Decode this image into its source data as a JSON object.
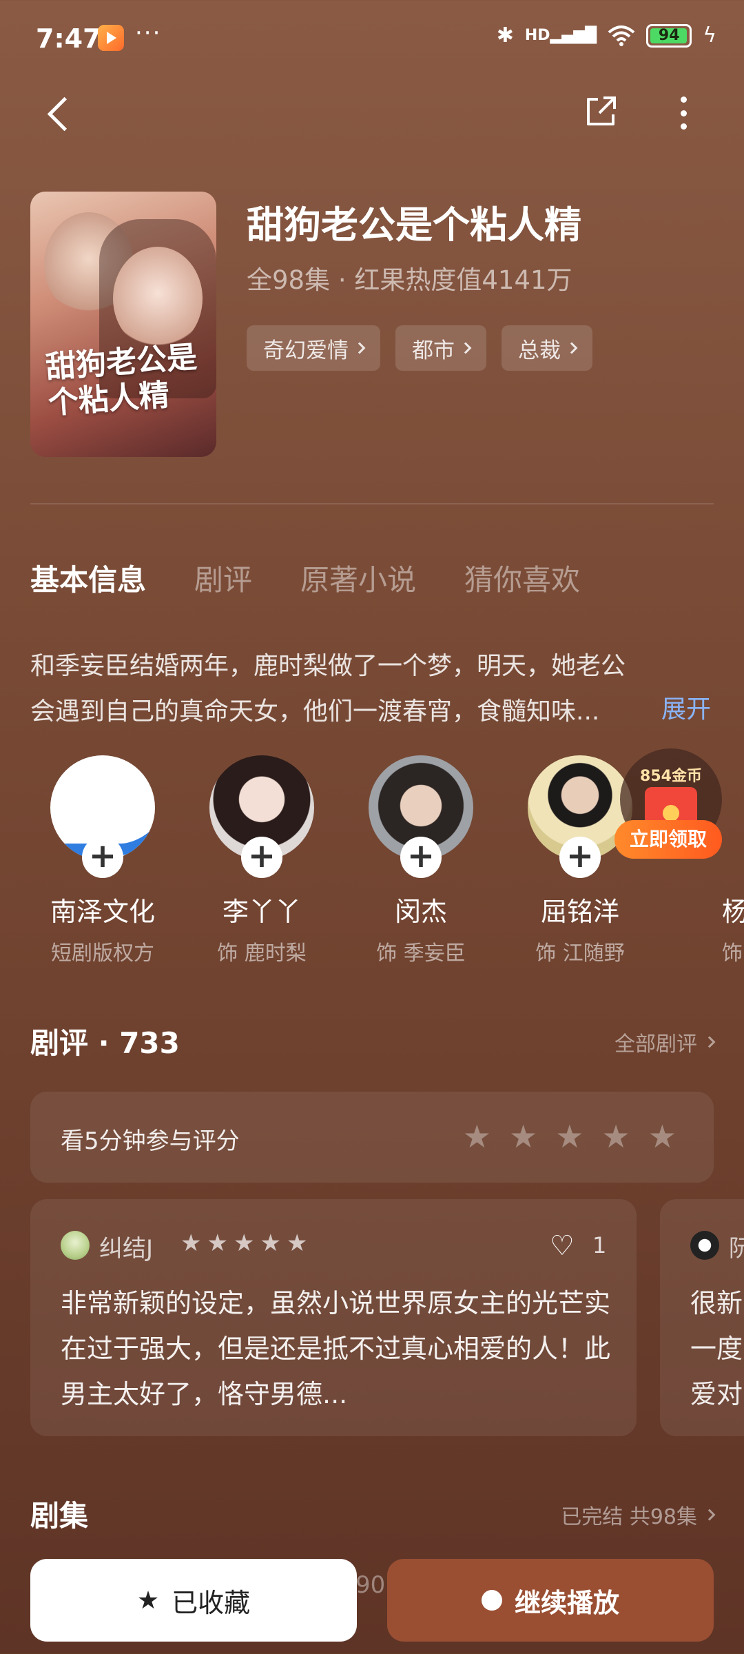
{
  "status_bar": {
    "time": "7:47",
    "dots": "···",
    "network": "HD",
    "battery": "94"
  },
  "show": {
    "poster_title": "甜狗老公是个粘人精",
    "title": "甜狗老公是个粘人精",
    "meta": "全98集 · 红果热度值4141万",
    "tags": [
      "奇幻爱情",
      "都市",
      "总裁"
    ]
  },
  "tabs": [
    "基本信息",
    "剧评",
    "原著小说",
    "猜你喜欢"
  ],
  "synopsis": {
    "text": "和季妄臣结婚两年，鹿时梨做了一个梦，明天，她老公会遇到自己的真命天女，他们一渡春宵，食髓知味...",
    "expand": "展开"
  },
  "cast": [
    {
      "name": "南泽文化",
      "role": "短剧版权方"
    },
    {
      "name": "李丫丫",
      "role": "饰 鹿时梨"
    },
    {
      "name": "闵杰",
      "role": "饰 季妄臣"
    },
    {
      "name": "屈铭洋",
      "role": "饰 江随野"
    },
    {
      "name": "杨",
      "role": "饰"
    }
  ],
  "reward": {
    "coins": "854金币",
    "button": "立即领取"
  },
  "reviews": {
    "title": "剧评 · 733",
    "all_link": "全部剧评",
    "rate_prompt": "看5分钟参与评分",
    "items": [
      {
        "user": "纠结J",
        "likes": "1",
        "text": "非常新颖的设定，虽然小说世界原女主的光芒实在过于强大，但是还是抵不过真心相爱的人！此男主太好了，恪守男德..."
      },
      {
        "user": "阮",
        "text": "很新 一度 爱对"
      }
    ]
  },
  "episodes": {
    "title": "剧集",
    "status": "已完结 共98集",
    "partial": "90"
  },
  "bottom": {
    "fav_label": "已收藏",
    "play_label": "继续播放"
  },
  "colors": {
    "background": "#7a4c37",
    "accent_link": "#8ab4f8",
    "play_button": "#9a4f33",
    "reward": "#ff6a22"
  },
  "icons": {
    "back": "back-arrow-icon",
    "share": "share-icon",
    "more": "more-vertical-icon",
    "star": "star-icon",
    "heart": "heart-icon",
    "play": "play-icon",
    "plus": "plus-icon"
  }
}
